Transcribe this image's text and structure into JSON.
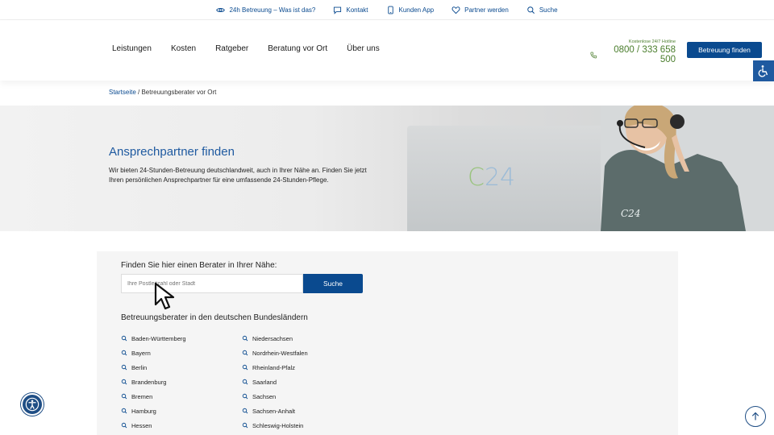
{
  "topbar": {
    "items": [
      {
        "label": "24h Betreuung – Was ist das?",
        "icon": "eye-icon"
      },
      {
        "label": "Kontakt",
        "icon": "chat-icon"
      },
      {
        "label": "Kunden App",
        "icon": "phone-device-icon"
      },
      {
        "label": "Partner werden",
        "icon": "heart-icon"
      },
      {
        "label": "Suche",
        "icon": "search-icon"
      }
    ]
  },
  "nav": {
    "items": [
      "Leistungen",
      "Kosten",
      "Ratgeber",
      "Beratung vor Ort",
      "Über uns"
    ]
  },
  "hotline": {
    "caption": "Kostenlose 24/7 Hotline",
    "number": "0800 / 333 658 500"
  },
  "header": {
    "cta_label": "Betreuung finden"
  },
  "breadcrumb": {
    "home": "Startseite",
    "separator": " / ",
    "current": "Betreuungsberater vor Ort"
  },
  "hero": {
    "title": "Ansprechpartner finden",
    "text": "Wir bieten 24-Stunden-Betreuung deutschlandweit, auch in Ihrer Nähe an. Finden Sie jetzt Ihren persönlichen Ansprechpartner für eine umfassende 24-Stunden-Pflege.",
    "logo_prefix": "C",
    "logo_number": "24",
    "shirt_logo": "C24"
  },
  "finder": {
    "title": "Finden Sie hier einen Berater in Ihrer Nähe:",
    "placeholder": "Ihre Postleitzahl oder Stadt",
    "search_label": "Suche",
    "states_title": "Betreuungsberater in den deutschen Bundesländern",
    "states": [
      "Baden-Württemberg",
      "Bayern",
      "Berlin",
      "Brandenburg",
      "Bremen",
      "Hamburg",
      "Hessen",
      "Niedersachsen",
      "Nordrhein-Westfalen",
      "Rheinland-Pfalz",
      "Saarland",
      "Sachsen",
      "Sachsen-Anhalt",
      "Schleswig-Holstein"
    ]
  },
  "colors": {
    "brand_blue": "#0a4a8f",
    "hotline_green": "#4a7d2c",
    "finder_bg": "#f5f5f5"
  }
}
